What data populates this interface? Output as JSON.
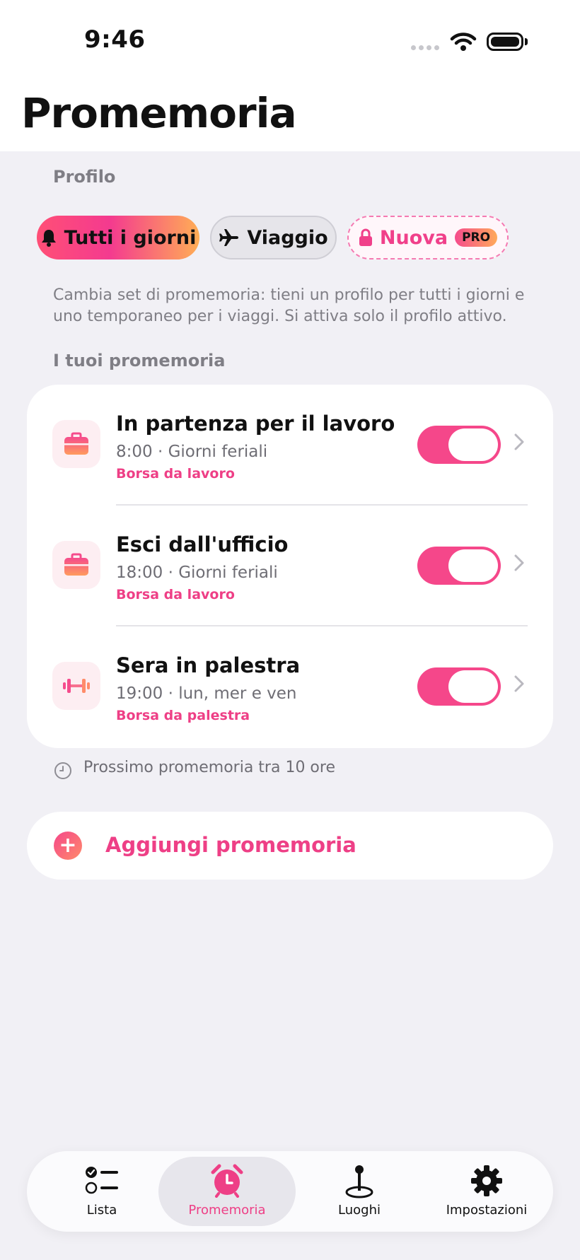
{
  "status_bar": {
    "time": "9:46"
  },
  "header": {
    "title": "Promemoria"
  },
  "profile": {
    "section_label": "Profilo",
    "chips": [
      {
        "label": "Tutti i giorni",
        "icon": "bell-icon",
        "active": true
      },
      {
        "label": "Viaggio",
        "icon": "airplane-icon",
        "active": false
      },
      {
        "label": "Nuova",
        "icon": "lock-icon",
        "badge": "PRO",
        "locked": true
      }
    ],
    "description": "Cambia set di promemoria: tieni un profilo per tutti i giorni e uno temporaneo per i viaggi. Si attiva solo il profilo attivo."
  },
  "reminders": {
    "section_label": "I tuoi promemoria",
    "items": [
      {
        "title": "In partenza per il lavoro",
        "subtitle": "8:00 · Giorni feriali",
        "bag": "Borsa da lavoro",
        "icon": "briefcase-icon",
        "enabled": true
      },
      {
        "title": "Esci dall'ufficio",
        "subtitle": "18:00 · Giorni feriali",
        "bag": "Borsa da lavoro",
        "icon": "briefcase-icon",
        "enabled": true
      },
      {
        "title": "Sera in palestra",
        "subtitle": "19:00 · lun, mer e ven",
        "bag": "Borsa da palestra",
        "icon": "dumbbell-icon",
        "enabled": true
      }
    ],
    "next_info": "Prossimo promemoria tra 10 ore"
  },
  "add": {
    "label": "Aggiungi promemoria"
  },
  "tabbar": {
    "tabs": [
      {
        "label": "Lista",
        "icon": "list-icon",
        "active": false
      },
      {
        "label": "Promemoria",
        "icon": "alarm-clock-icon",
        "active": true
      },
      {
        "label": "Luoghi",
        "icon": "map-pin-icon",
        "active": false
      },
      {
        "label": "Impostazioni",
        "icon": "gear-icon",
        "active": false
      }
    ]
  },
  "colors": {
    "accent": "#ee3f86",
    "background": "#f1f0f5",
    "toggle_on": "#f5478a"
  }
}
